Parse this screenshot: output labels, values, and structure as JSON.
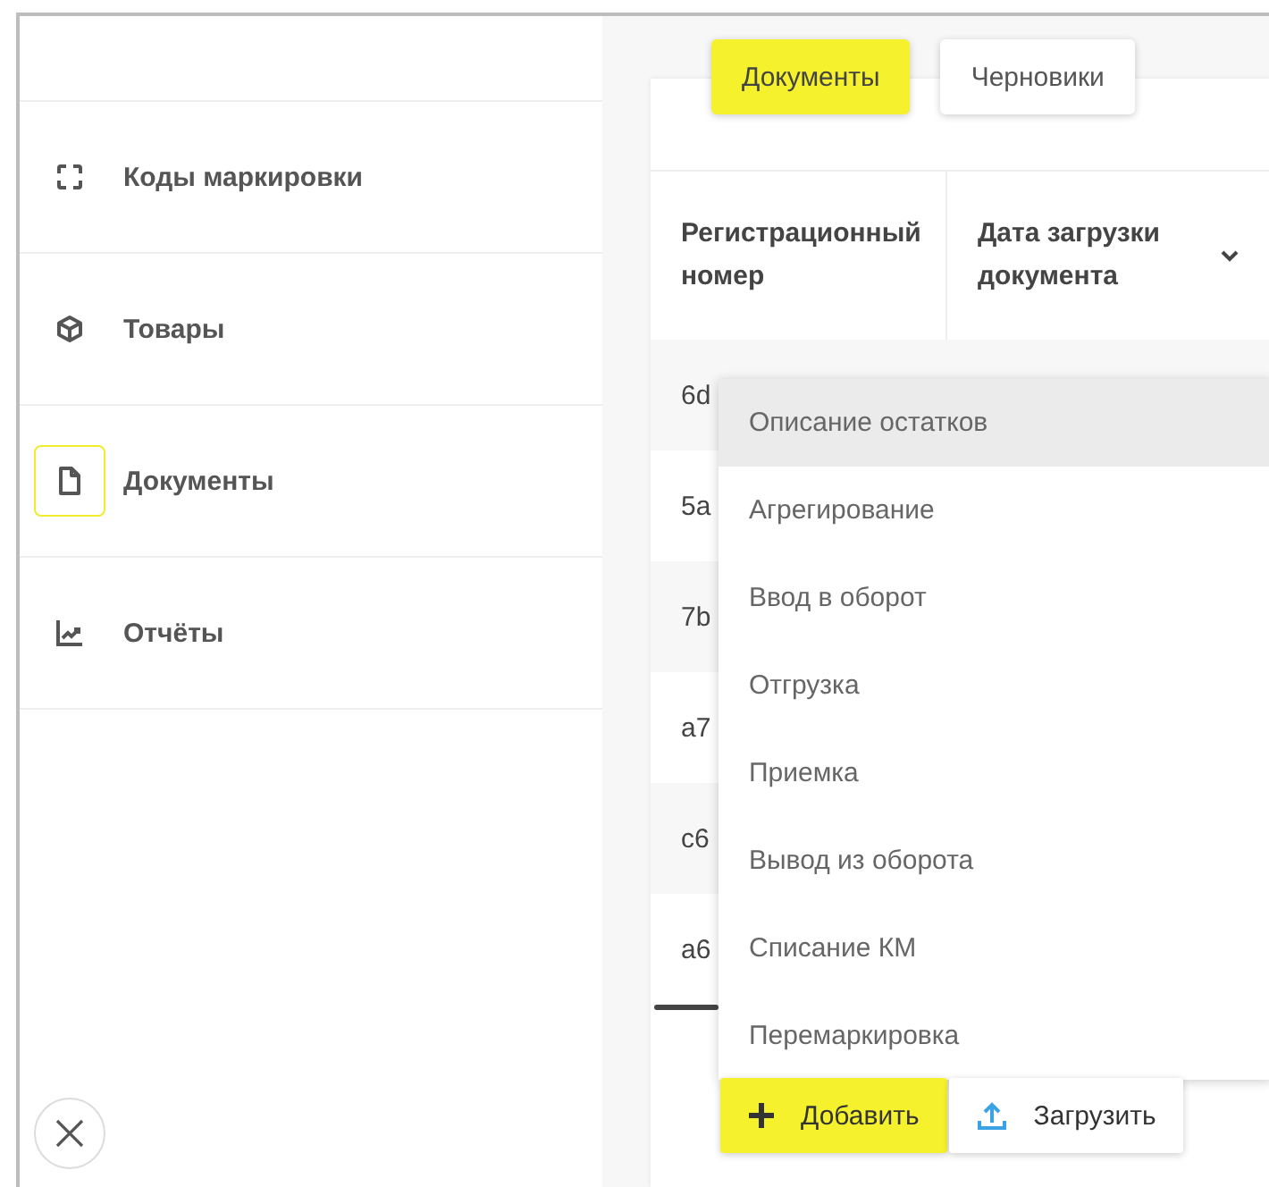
{
  "sidebar": {
    "items": [
      {
        "label": "Коды маркировки",
        "selected": false
      },
      {
        "label": "Товары",
        "selected": false
      },
      {
        "label": "Документы",
        "selected": true
      },
      {
        "label": "Отчёты",
        "selected": false
      }
    ]
  },
  "tabs": [
    {
      "label": "Документы",
      "selected": true
    },
    {
      "label": "Черновики",
      "selected": false
    }
  ],
  "table": {
    "columns": [
      {
        "label": "Регистрационный номер",
        "sortable": false
      },
      {
        "label": "Дата загрузки документа",
        "sortable": true
      }
    ],
    "rows": [
      [
        "6d"
      ],
      [
        "5a"
      ],
      [
        "7b"
      ],
      [
        "a7"
      ],
      [
        "c6"
      ],
      [
        "a6"
      ]
    ]
  },
  "dropdown": {
    "items": [
      {
        "label": "Описание остатков",
        "selected": true
      },
      {
        "label": "Агрегирование",
        "selected": false
      },
      {
        "label": "Ввод в оборот",
        "selected": false
      },
      {
        "label": "Отгрузка",
        "selected": false
      },
      {
        "label": "Приемка",
        "selected": false
      },
      {
        "label": "Вывод из оборота",
        "selected": false
      },
      {
        "label": "Списание КМ",
        "selected": false
      },
      {
        "label": "Перемаркировка",
        "selected": false
      }
    ]
  },
  "buttons": [
    {
      "label": "Добавить",
      "kind": "add"
    },
    {
      "label": "Загрузить",
      "kind": "upload"
    }
  ]
}
